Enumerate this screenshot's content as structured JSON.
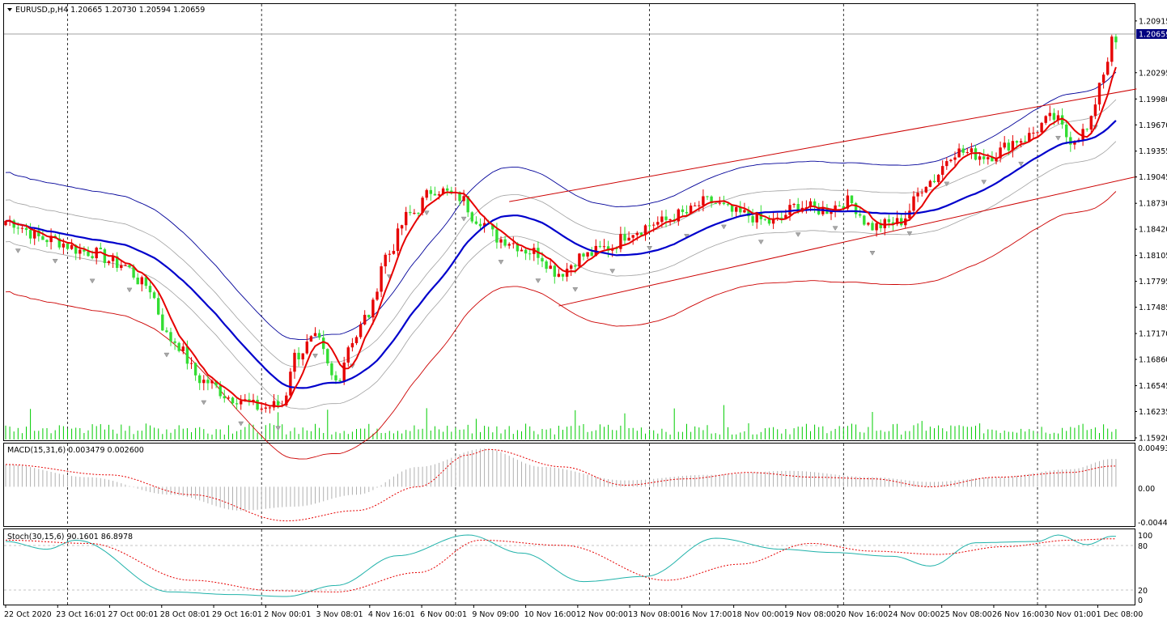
{
  "main": {
    "header": "EURUSD,p,H4  1.20665 1.20730 1.20594 1.20659",
    "price_labels": [
      "1.20915",
      "1.20295",
      "1.19980",
      "1.19670",
      "1.19355",
      "1.19045",
      "1.18730",
      "1.18420",
      "1.18105",
      "1.17795",
      "1.17485",
      "1.17170",
      "1.16860",
      "1.16545",
      "1.16235",
      "1.15920"
    ],
    "current_price": "1.20659",
    "price_min": 1.1592,
    "price_max": 1.2103
  },
  "macd": {
    "header": "MACD(15,31,6) 0.003479 0.002600",
    "labels": [
      "0.004934",
      "0.00",
      "-0.00444"
    ],
    "ymin": -0.00444,
    "ymax": 0.004934
  },
  "stoch": {
    "header": "Stoch(30,15,6) 90.1601 86.8978",
    "labels": [
      "100",
      "80",
      "20",
      "0"
    ]
  },
  "time_labels": [
    "22 Oct 2020",
    "23 Oct 16:01",
    "27 Oct 00:01",
    "28 Oct 08:01",
    "29 Oct 16:01",
    "2 Nov 00:01",
    "3 Nov 08:01",
    "4 Nov 16:01",
    "6 Nov 00:01",
    "9 Nov 09:00",
    "10 Nov 16:00",
    "12 Nov 00:00",
    "13 Nov 08:00",
    "16 Nov 17:00",
    "18 Nov 00:00",
    "19 Nov 08:00",
    "20 Nov 16:00",
    "24 Nov 00:00",
    "25 Nov 08:00",
    "26 Nov 16:00",
    "30 Nov 01:00",
    "1 Dec 08:00"
  ],
  "chart_data": {
    "type": "candlestick",
    "symbol": "EURUSD,p",
    "timeframe": "H4",
    "ylim": [
      1.1592,
      1.2103
    ],
    "anchors": [
      [
        0,
        1.1852
      ],
      [
        10,
        1.183
      ],
      [
        20,
        1.1815
      ],
      [
        28,
        1.18
      ],
      [
        34,
        1.1775
      ],
      [
        40,
        1.171
      ],
      [
        48,
        1.166
      ],
      [
        55,
        1.164
      ],
      [
        62,
        1.1628
      ],
      [
        67,
        1.1632
      ],
      [
        70,
        1.169
      ],
      [
        75,
        1.171
      ],
      [
        80,
        1.166
      ],
      [
        84,
        1.171
      ],
      [
        88,
        1.174
      ],
      [
        92,
        1.181
      ],
      [
        98,
        1.186
      ],
      [
        104,
        1.189
      ],
      [
        110,
        1.188
      ],
      [
        114,
        1.1855
      ],
      [
        120,
        1.183
      ],
      [
        128,
        1.1815
      ],
      [
        134,
        1.179
      ],
      [
        140,
        1.181
      ],
      [
        146,
        1.182
      ],
      [
        152,
        1.184
      ],
      [
        158,
        1.185
      ],
      [
        164,
        1.186
      ],
      [
        170,
        1.1875
      ],
      [
        178,
        1.186
      ],
      [
        186,
        1.185
      ],
      [
        192,
        1.187
      ],
      [
        198,
        1.1865
      ],
      [
        204,
        1.1875
      ],
      [
        210,
        1.1845
      ],
      [
        216,
        1.185
      ],
      [
        224,
        1.19
      ],
      [
        230,
        1.1935
      ],
      [
        238,
        1.193
      ],
      [
        246,
        1.195
      ],
      [
        254,
        1.1975
      ],
      [
        258,
        1.195
      ],
      [
        262,
        1.196
      ],
      [
        266,
        1.203
      ],
      [
        268,
        1.2066
      ]
    ],
    "macd_histogram_anchors": [
      [
        0,
        0.0028
      ],
      [
        20,
        0.0012
      ],
      [
        40,
        -0.001
      ],
      [
        57,
        -0.003
      ],
      [
        70,
        -0.0025
      ],
      [
        85,
        -0.001
      ],
      [
        100,
        0.0025
      ],
      [
        116,
        0.0048
      ],
      [
        130,
        0.0025
      ],
      [
        150,
        0.0008
      ],
      [
        170,
        0.0015
      ],
      [
        190,
        0.002
      ],
      [
        210,
        0.0012
      ],
      [
        224,
        0.0006
      ],
      [
        240,
        0.0012
      ],
      [
        258,
        0.0022
      ],
      [
        268,
        0.0035
      ]
    ],
    "macd_signal_anchors": [
      [
        0,
        0.0028
      ],
      [
        25,
        0.0015
      ],
      [
        45,
        -0.001
      ],
      [
        68,
        -0.0043
      ],
      [
        85,
        -0.003
      ],
      [
        100,
        0.0
      ],
      [
        112,
        0.004
      ],
      [
        117,
        0.0047
      ],
      [
        135,
        0.0025
      ],
      [
        150,
        0.0002
      ],
      [
        165,
        0.001
      ],
      [
        180,
        0.0018
      ],
      [
        196,
        0.0012
      ],
      [
        210,
        0.001
      ],
      [
        224,
        0.0
      ],
      [
        240,
        0.0012
      ],
      [
        258,
        0.0018
      ],
      [
        268,
        0.0026
      ]
    ],
    "stoch_k_anchors": [
      [
        0,
        90
      ],
      [
        10,
        78
      ],
      [
        17,
        92
      ],
      [
        40,
        12
      ],
      [
        55,
        8
      ],
      [
        68,
        5
      ],
      [
        80,
        22
      ],
      [
        95,
        68
      ],
      [
        112,
        100
      ],
      [
        125,
        72
      ],
      [
        140,
        28
      ],
      [
        155,
        36
      ],
      [
        172,
        95
      ],
      [
        188,
        78
      ],
      [
        200,
        73
      ],
      [
        215,
        67
      ],
      [
        224,
        52
      ],
      [
        235,
        88
      ],
      [
        250,
        90
      ],
      [
        255,
        100
      ],
      [
        262,
        85
      ],
      [
        268,
        98
      ]
    ],
    "stoch_d_anchors": [
      [
        0,
        92
      ],
      [
        20,
        87
      ],
      [
        45,
        30
      ],
      [
        65,
        14
      ],
      [
        80,
        12
      ],
      [
        100,
        42
      ],
      [
        115,
        92
      ],
      [
        135,
        84
      ],
      [
        160,
        30
      ],
      [
        178,
        55
      ],
      [
        195,
        87
      ],
      [
        210,
        75
      ],
      [
        226,
        70
      ],
      [
        242,
        82
      ],
      [
        258,
        92
      ],
      [
        268,
        94
      ]
    ],
    "annotation": "Linear regression channel from 9 Nov 09:00"
  }
}
